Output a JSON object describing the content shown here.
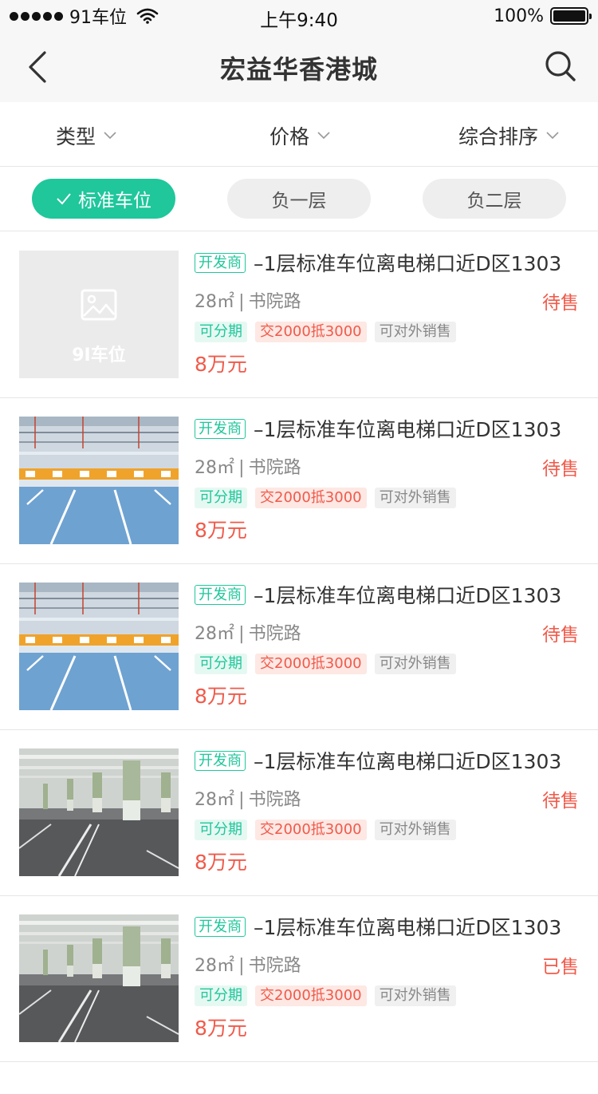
{
  "status_bar": {
    "carrier": "91车位",
    "time": "上午9:40",
    "battery": "100%"
  },
  "nav": {
    "title": "宏益华香港城"
  },
  "filters": [
    {
      "label": "类型"
    },
    {
      "label": "价格"
    },
    {
      "label": "综合排序"
    }
  ],
  "chips": [
    {
      "label": "标准车位",
      "active": true
    },
    {
      "label": "负一层",
      "active": false
    },
    {
      "label": "负二层",
      "active": false
    }
  ],
  "placeholder_logo": "9I车位",
  "listings": [
    {
      "dev_tag": "开发商",
      "title": "–1层标准车位离电梯口近D区1303",
      "area": "28㎡",
      "sep": "|",
      "road": "书院路",
      "status": "待售",
      "tags": [
        "可分期",
        "交2000抵3000",
        "可对外销售"
      ],
      "price": "8万元",
      "image": "placeholder"
    },
    {
      "dev_tag": "开发商",
      "title": "–1层标准车位离电梯口近D区1303",
      "area": "28㎡",
      "sep": "|",
      "road": "书院路",
      "status": "待售",
      "tags": [
        "可分期",
        "交2000抵3000",
        "可对外销售"
      ],
      "price": "8万元",
      "image": "garage-blue"
    },
    {
      "dev_tag": "开发商",
      "title": "–1层标准车位离电梯口近D区1303",
      "area": "28㎡",
      "sep": "|",
      "road": "书院路",
      "status": "待售",
      "tags": [
        "可分期",
        "交2000抵3000",
        "可对外销售"
      ],
      "price": "8万元",
      "image": "garage-blue"
    },
    {
      "dev_tag": "开发商",
      "title": "–1层标准车位离电梯口近D区1303",
      "area": "28㎡",
      "sep": "|",
      "road": "书院路",
      "status": "待售",
      "tags": [
        "可分期",
        "交2000抵3000",
        "可对外销售"
      ],
      "price": "8万元",
      "image": "garage-pillars"
    },
    {
      "dev_tag": "开发商",
      "title": "–1层标准车位离电梯口近D区1303",
      "area": "28㎡",
      "sep": "|",
      "road": "书院路",
      "status": "已售",
      "tags": [
        "可分期",
        "交2000抵3000",
        "可对外销售"
      ],
      "price": "8万元",
      "image": "garage-pillars"
    }
  ],
  "colors": {
    "accent": "#1fc79b",
    "price": "#f05a4a"
  }
}
